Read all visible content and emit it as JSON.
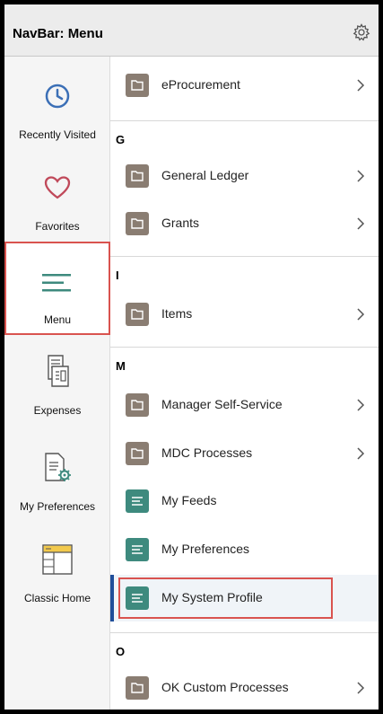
{
  "header": {
    "title": "NavBar: Menu",
    "gear_icon": "gear-icon"
  },
  "sidebar": {
    "recently_visited": "Recently Visited",
    "favorites": "Favorites",
    "menu": "Menu",
    "expenses": "Expenses",
    "my_preferences": "My Preferences",
    "classic_home": "Classic Home"
  },
  "menu": {
    "eprocurement": "eProcurement",
    "section_g": "G",
    "general_ledger": "General Ledger",
    "grants": "Grants",
    "section_i": "I",
    "items": "Items",
    "section_m": "M",
    "manager_self_service": "Manager Self-Service",
    "mdc_processes": "MDC Processes",
    "my_feeds": "My Feeds",
    "my_preferences": "My Preferences",
    "my_system_profile": "My System Profile",
    "section_o": "O",
    "ok_custom_processes": "OK Custom Processes"
  },
  "colors": {
    "folder": "#8a7d72",
    "feed": "#3e8a7e",
    "highlight": "#d9534f",
    "active_bar": "#1f4e9a",
    "clock": "#3b6fb6",
    "heart": "#c0495a"
  }
}
